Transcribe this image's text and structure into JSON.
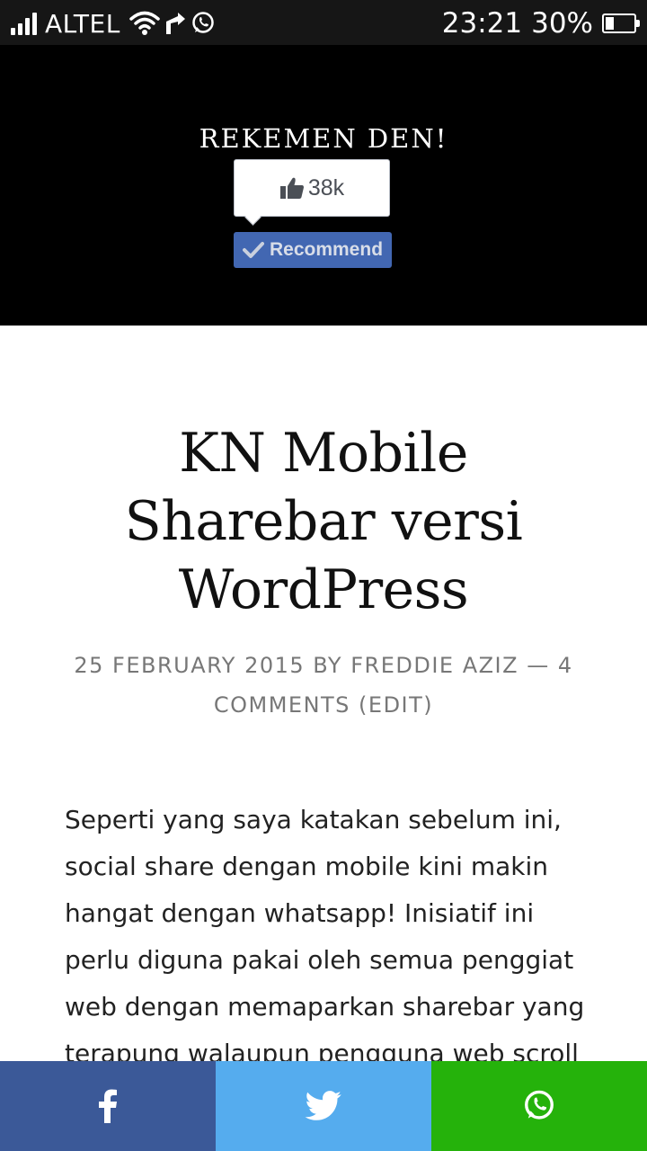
{
  "status_bar": {
    "carrier": "ALTEL",
    "time": "23:21",
    "battery_percent": "30%",
    "battery_level": 0.3,
    "icons": [
      "signal-icon",
      "wifi-icon",
      "send-icon",
      "whatsapp-icon",
      "battery-icon"
    ]
  },
  "header": {
    "title": "REKEMEN DEN!",
    "like_count": "38k",
    "recommend_label": "Recommend"
  },
  "post": {
    "title": "KN Mobile Sharebar versi WordPress",
    "meta": "25 FEBRUARY 2015 BY FREDDIE AZIZ — 4 COMMENTS (EDIT)",
    "body": "Seperti yang saya katakan sebelum ini, social share dengan mobile kini makin hangat dengan whatsapp! Inisiatif ini perlu diguna pakai oleh semua penggiat web dengan memaparkan sharebar yang terapung walaupun pengguna web scroll"
  },
  "sharebar": {
    "buttons": [
      {
        "icon": "facebook-icon",
        "color": "#3b5998"
      },
      {
        "icon": "twitter-icon",
        "color": "#55acee"
      },
      {
        "icon": "whatsapp-icon",
        "color": "#25b20b"
      }
    ]
  }
}
